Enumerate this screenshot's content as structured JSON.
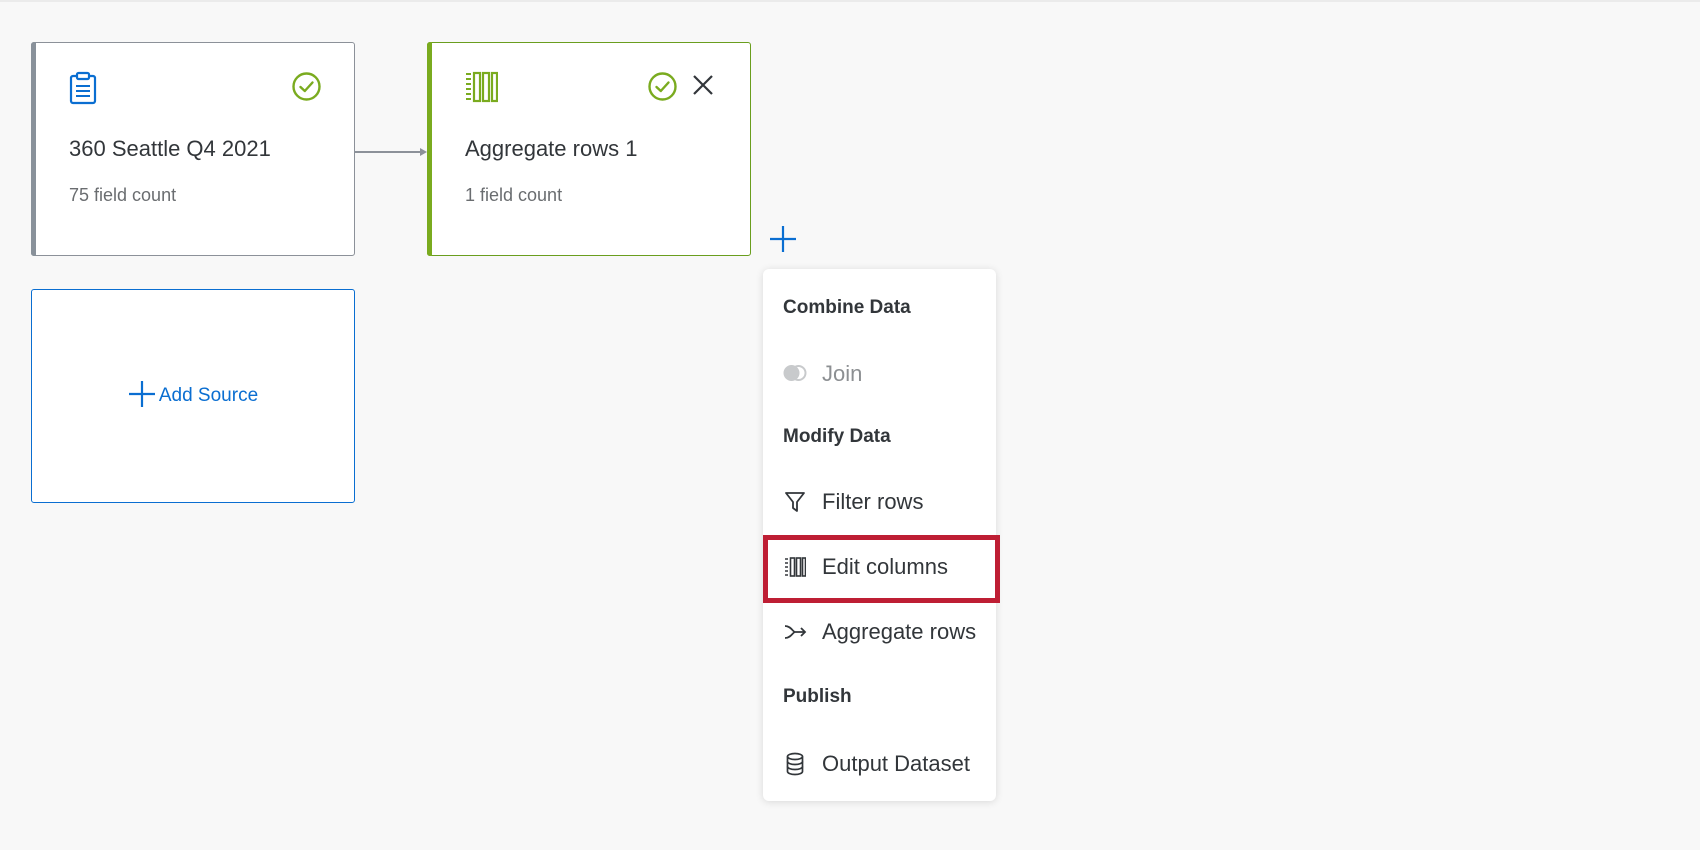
{
  "colors": {
    "accent_blue": "#0a6ed1",
    "success_green": "#7aab1f",
    "source_gray": "#89919a",
    "highlight_red": "#be1e34"
  },
  "nodes": [
    {
      "title": "360 Seattle Q4 2021",
      "subtitle": "75 field count",
      "type_icon": "clipboard-icon",
      "status_icon": "check-circle-icon"
    },
    {
      "title": "Aggregate rows 1",
      "subtitle": "1 field count",
      "type_icon": "edit-columns-icon",
      "status_icon": "check-circle-icon",
      "close_icon": "close-icon"
    }
  ],
  "add_source": {
    "label": "Add Source",
    "icon": "plus-icon"
  },
  "add_step": {
    "icon": "plus-icon"
  },
  "menu": {
    "sections": [
      {
        "label": "Combine Data"
      },
      {
        "label": "Modify Data"
      },
      {
        "label": "Publish"
      }
    ],
    "items": [
      {
        "label": "Join",
        "icon": "join-icon",
        "disabled": true
      },
      {
        "label": "Filter rows",
        "icon": "funnel-icon"
      },
      {
        "label": "Edit columns",
        "icon": "edit-columns-icon",
        "highlighted": true
      },
      {
        "label": "Aggregate rows",
        "icon": "aggregate-icon"
      },
      {
        "label": "Output Dataset",
        "icon": "database-icon"
      }
    ]
  }
}
